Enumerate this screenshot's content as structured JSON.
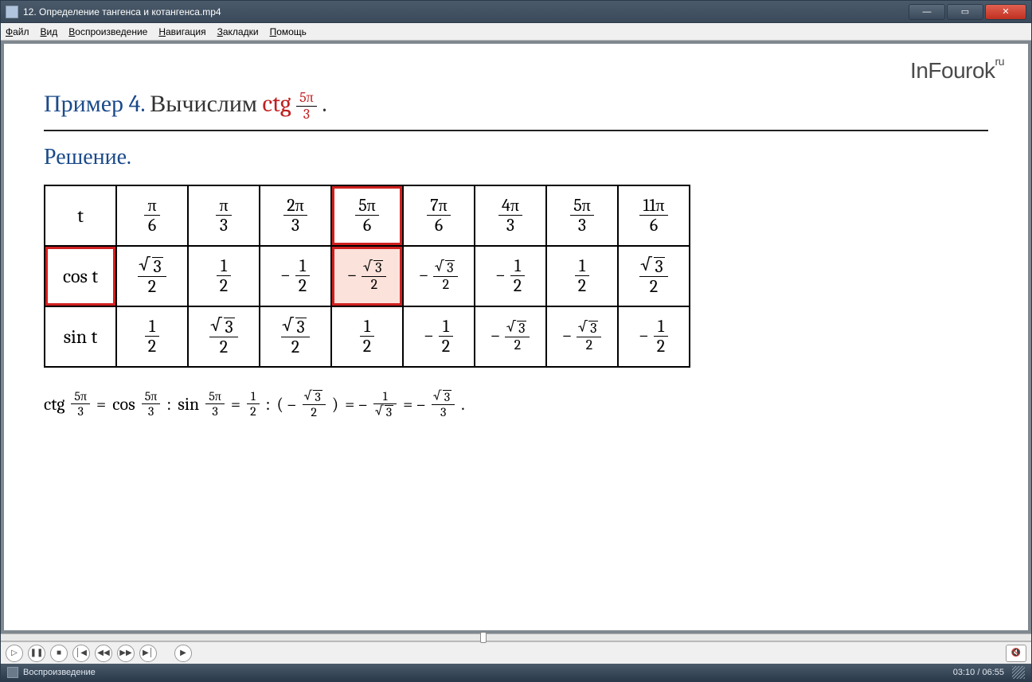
{
  "window": {
    "title": "12. Определение тангенса и котангенса.mp4"
  },
  "menu": {
    "file": "Файл",
    "view": "Вид",
    "playback": "Воспроизведение",
    "nav": "Навигация",
    "bookmarks": "Закладки",
    "help": "Помощь"
  },
  "status": {
    "state": "Воспроизведение",
    "current_time": "03:10",
    "total_time": "06:55"
  },
  "slide": {
    "brand": "InFourok",
    "brand_suffix": "ru",
    "example_label": "Пример 4.",
    "problem_prefix": "Вычислим",
    "problem_func": "ctg",
    "problem_arg": {
      "num": "5π",
      "den": "3"
    },
    "problem_period": ".",
    "solution_label": "Решение.",
    "table": {
      "rows": [
        {
          "head": "t",
          "cells": [
            {
              "num": "π",
              "den": "6"
            },
            {
              "num": "π",
              "den": "3"
            },
            {
              "num": "2π",
              "den": "3"
            },
            {
              "num": "5π",
              "den": "6",
              "hl": "red"
            },
            {
              "num": "7π",
              "den": "6"
            },
            {
              "num": "4π",
              "den": "3"
            },
            {
              "num": "5π",
              "den": "3"
            },
            {
              "num": "11π",
              "den": "6"
            }
          ]
        },
        {
          "head": "cos t",
          "head_hl": "red",
          "cells": [
            {
              "num": "√3",
              "den": "2"
            },
            {
              "num": "1",
              "den": "2"
            },
            {
              "neg": true,
              "num": "1",
              "den": "2"
            },
            {
              "neg": true,
              "num": "√3",
              "den": "2",
              "hl": "pink",
              "small": true
            },
            {
              "neg": true,
              "num": "√3",
              "den": "2",
              "small": true
            },
            {
              "neg": true,
              "num": "1",
              "den": "2"
            },
            {
              "num": "1",
              "den": "2"
            },
            {
              "num": "√3",
              "den": "2"
            }
          ]
        },
        {
          "head": "sin t",
          "cells": [
            {
              "num": "1",
              "den": "2"
            },
            {
              "num": "√3",
              "den": "2"
            },
            {
              "num": "√3",
              "den": "2"
            },
            {
              "num": "1",
              "den": "2"
            },
            {
              "neg": true,
              "num": "1",
              "den": "2"
            },
            {
              "neg": true,
              "num": "√3",
              "den": "2",
              "small": true
            },
            {
              "neg": true,
              "num": "√3",
              "den": "2",
              "small": true
            },
            {
              "neg": true,
              "num": "1",
              "den": "2"
            }
          ]
        }
      ]
    },
    "equation": {
      "parts": [
        {
          "type": "text",
          "val": "ctg"
        },
        {
          "type": "frac",
          "num": "5π",
          "den": "3",
          "size": "tiny"
        },
        {
          "type": "text",
          "val": "="
        },
        {
          "type": "text",
          "val": "cos"
        },
        {
          "type": "frac",
          "num": "5π",
          "den": "3",
          "size": "tiny"
        },
        {
          "type": "text",
          "val": ":"
        },
        {
          "type": "text",
          "val": "sin"
        },
        {
          "type": "frac",
          "num": "5π",
          "den": "3",
          "size": "tiny"
        },
        {
          "type": "text",
          "val": " ="
        },
        {
          "type": "frac",
          "num": "1",
          "den": "2",
          "size": "tiny"
        },
        {
          "type": "text",
          "val": ":"
        },
        {
          "type": "text",
          "val": "( –"
        },
        {
          "type": "frac",
          "num": "√3",
          "den": "2",
          "size": "tiny"
        },
        {
          "type": "text",
          "val": ")"
        },
        {
          "type": "text",
          "val": " = –"
        },
        {
          "type": "frac",
          "num": "1",
          "den": "√3",
          "size": "tiny"
        },
        {
          "type": "text",
          "val": " = –"
        },
        {
          "type": "frac",
          "num": "√3",
          "den": "3",
          "size": "tiny"
        },
        {
          "type": "text",
          "val": "."
        }
      ]
    }
  }
}
